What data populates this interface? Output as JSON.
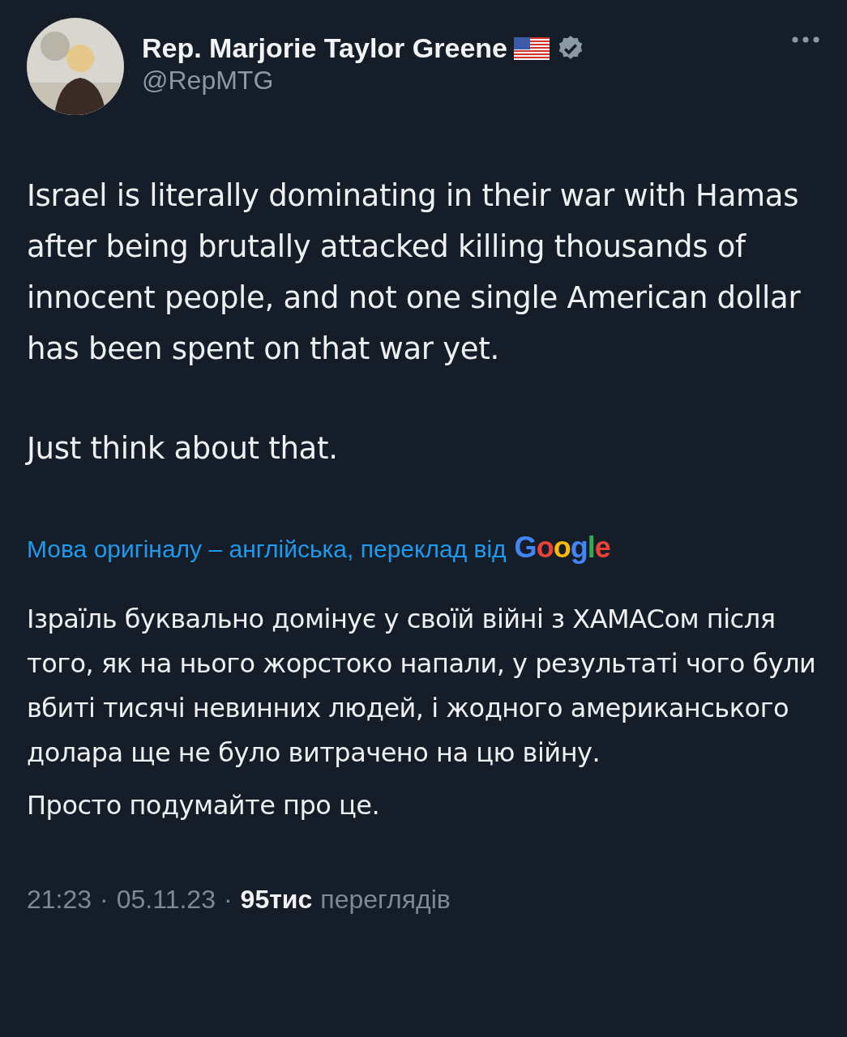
{
  "author": {
    "name": "Rep. Marjorie Taylor Greene",
    "handle": "@RepMTG",
    "verified": true
  },
  "post": {
    "paragraphs": [
      "Israel is literally dominating in their war with Hamas after being brutally attacked killing thousands of innocent people, and not one single American dollar has been spent on that war yet.",
      "Just think about that."
    ]
  },
  "translation": {
    "notice": "Мова оригіналу – англійська, переклад від",
    "provider": "Google",
    "paragraphs": [
      "Ізраїль буквально домінує у своїй війні з ХАМАСом після того, як на нього жорстоко напали, у результаті чого були вбиті тисячі невинних людей, і жодного американського долара ще не було витрачено на цю війну.",
      "Просто подумайте про це."
    ]
  },
  "meta": {
    "time": "21:23",
    "separator": "·",
    "date": "05.11.23",
    "views_count": "95тис",
    "views_label": "переглядів"
  }
}
